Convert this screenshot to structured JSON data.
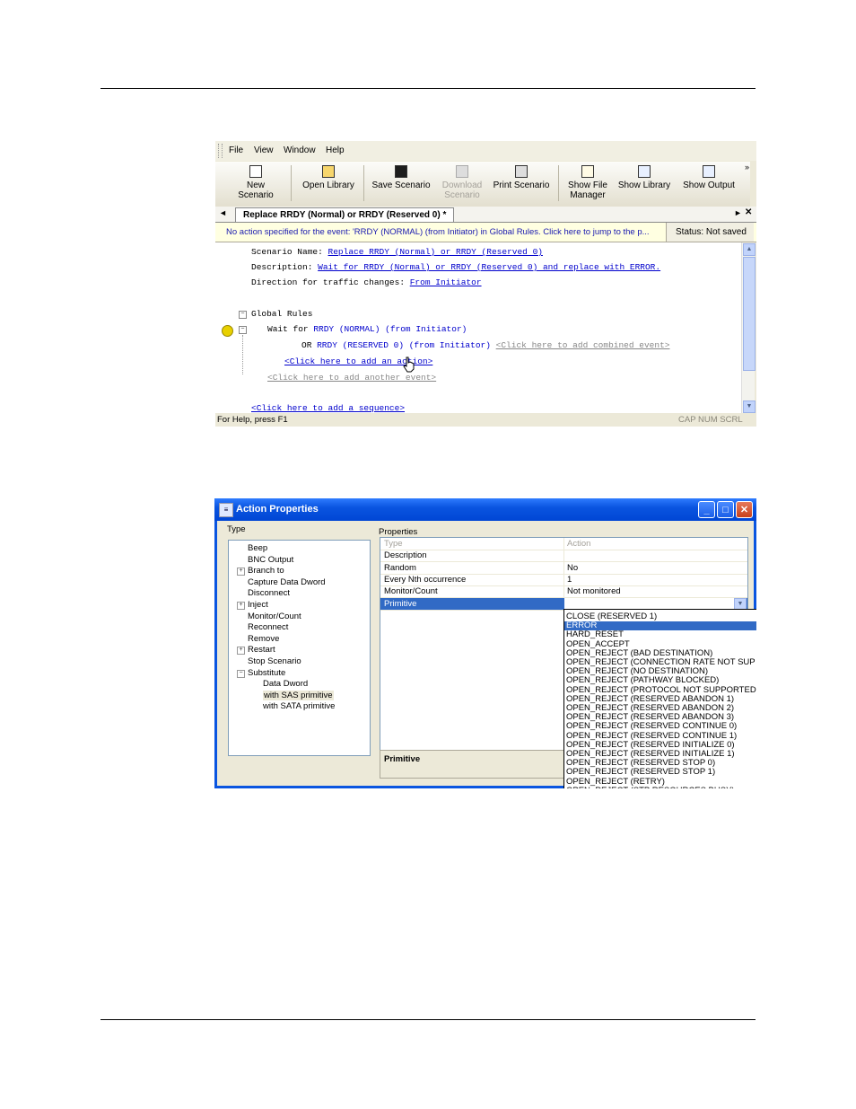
{
  "editor_window": {
    "menu": [
      "File",
      "View",
      "Window",
      "Help"
    ],
    "toolbar": [
      {
        "label": "New Scenario",
        "icon": "new-document-icon",
        "enabled": true
      },
      {
        "label": "Open Library",
        "icon": "open-folder-icon",
        "enabled": true
      },
      {
        "label": "Save Scenario",
        "icon": "floppy-disk-icon",
        "enabled": true
      },
      {
        "label": "Download Scenario",
        "icon": "download-icon",
        "enabled": false
      },
      {
        "label": "Print Scenario",
        "icon": "printer-icon",
        "enabled": true
      },
      {
        "label": "Show File Manager",
        "icon": "file-manager-icon",
        "enabled": true
      },
      {
        "label": "Show Library",
        "icon": "library-icon",
        "enabled": true
      },
      {
        "label": "Show Output",
        "icon": "output-window-icon",
        "enabled": true
      }
    ],
    "toolbar_more": "»",
    "tab": {
      "title": "Replace RRDY (Normal) or RRDY (Reserved 0)",
      "modified_marker": "*"
    },
    "nav": {
      "left": "◄",
      "right": "►",
      "close": "✕"
    },
    "info_message": "No action specified for the event: 'RRDY (NORMAL) (from Initiator) in Global Rules. Click here to jump to the p...",
    "status": "Status: Not saved",
    "scenario": {
      "name_label": "Scenario Name:",
      "name": "Replace RRDY (Normal) or RRDY (Reserved 0)",
      "description_label": "Description:",
      "description": "Wait for RRDY (Normal) or RRDY (Reserved 0) and replace with ERROR.",
      "direction_label": "Direction for traffic changes:",
      "direction": "From Initiator",
      "global_rules": "Global Rules",
      "wait_for": "Wait for",
      "event1": "RRDY (NORMAL) (from Initiator)",
      "or": "OR",
      "event2": "RRDY (RESERVED 0) (from Initiator)",
      "add_combined": "<Click here to add combined event>",
      "add_action": "<Click here to add an action>",
      "add_event": "<Click here to add another event>",
      "add_sequence": "<Click here to add a sequence>"
    },
    "statusbar": {
      "help": "For Help, press F1",
      "indicators": "CAP  NUM  SCRL"
    }
  },
  "dialog": {
    "title": "Action Properties",
    "type_label": "Type",
    "properties_label": "Properties",
    "tree": [
      {
        "label": "Beep",
        "level": 0,
        "expander": ""
      },
      {
        "label": "BNC Output",
        "level": 0,
        "expander": ""
      },
      {
        "label": "Branch to",
        "level": 0,
        "expander": "+"
      },
      {
        "label": "Capture Data Dword",
        "level": 0,
        "expander": ""
      },
      {
        "label": "Disconnect",
        "level": 0,
        "expander": ""
      },
      {
        "label": "Inject",
        "level": 0,
        "expander": "+"
      },
      {
        "label": "Monitor/Count",
        "level": 0,
        "expander": ""
      },
      {
        "label": "Reconnect",
        "level": 0,
        "expander": ""
      },
      {
        "label": "Remove",
        "level": 0,
        "expander": ""
      },
      {
        "label": "Restart",
        "level": 0,
        "expander": "+"
      },
      {
        "label": "Stop Scenario",
        "level": 0,
        "expander": ""
      },
      {
        "label": "Substitute",
        "level": 0,
        "expander": "-"
      },
      {
        "label": "Data Dword",
        "level": 1,
        "expander": ""
      },
      {
        "label": "with SAS primitive",
        "level": 1,
        "expander": "",
        "selected": true
      },
      {
        "label": "with SATA primitive",
        "level": 1,
        "expander": ""
      }
    ],
    "properties": [
      {
        "name": "Type",
        "value": "Action",
        "disabled": true
      },
      {
        "name": "Description",
        "value": ""
      },
      {
        "name": "Random",
        "value": "No"
      },
      {
        "name": "Every Nth occurrence",
        "value": "1"
      },
      {
        "name": "Monitor/Count",
        "value": "Not monitored"
      },
      {
        "name": "Primitive",
        "value": "",
        "selected": true
      }
    ],
    "description_title": "Primitive",
    "dropdown_options": [
      "CLOSE (RESERVED 1)",
      "ERROR",
      "HARD_RESET",
      "OPEN_ACCEPT",
      "OPEN_REJECT (BAD DESTINATION)",
      "OPEN_REJECT (CONNECTION RATE NOT SUP",
      "OPEN_REJECT (NO DESTINATION)",
      "OPEN_REJECT (PATHWAY BLOCKED)",
      "OPEN_REJECT (PROTOCOL NOT SUPPORTED",
      "OPEN_REJECT (RESERVED ABANDON 1)",
      "OPEN_REJECT (RESERVED ABANDON 2)",
      "OPEN_REJECT (RESERVED ABANDON 3)",
      "OPEN_REJECT (RESERVED CONTINUE 0)",
      "OPEN_REJECT (RESERVED CONTINUE 1)",
      "OPEN_REJECT (RESERVED INITIALIZE 0)",
      "OPEN_REJECT (RESERVED INITIALIZE 1)",
      "OPEN_REJECT (RESERVED STOP 0)",
      "OPEN_REJECT (RESERVED STOP 1)",
      "OPEN_REJECT (RETRY)",
      "OPEN_REJECT (STP RESOURCES BUSY)"
    ],
    "dropdown_selected": "ERROR"
  }
}
